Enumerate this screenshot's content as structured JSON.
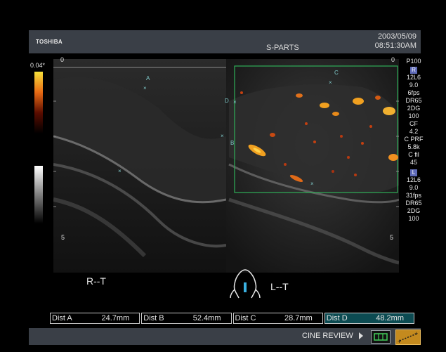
{
  "header": {
    "brand": "TOSHIBA",
    "preset": "S-PARTS",
    "date": "2003/05/09",
    "time": "08:51:30AM"
  },
  "image": {
    "depth_top": "0",
    "depth_mid": "5",
    "color_scale_top": "0.04*",
    "labels": {
      "left": "R--T",
      "right": "L--T"
    },
    "markers": [
      "A",
      "B",
      "C",
      "D"
    ]
  },
  "params_upper": {
    "power": "P100",
    "r_badge": "R",
    "probe": "12L6",
    "freq": "9.0",
    "fps": "6fps",
    "dr": "DR65",
    "mode": "2DG",
    "gain": "100",
    "cf_label": "CF",
    "cf": "4.2",
    "cprf_label": "C PRF",
    "cprf": "5.8k",
    "cfil_label": "C fil",
    "cfil": "45"
  },
  "params_lower": {
    "l_badge": "L",
    "probe": "12L6",
    "freq": "9.0",
    "fps": "31fps",
    "dr": "DR65",
    "mode": "2DG",
    "gain": "100"
  },
  "measurements": [
    {
      "key": "Dist A",
      "value": "24.7mm"
    },
    {
      "key": "Dist B",
      "value": "52.4mm"
    },
    {
      "key": "Dist C",
      "value": "28.7mm"
    },
    {
      "key": "Dist D",
      "value": "48.2mm"
    }
  ],
  "footer": {
    "cine": "CINE REVIEW"
  },
  "colors": {
    "panel": "#3a3f47",
    "roi": "#2fae58",
    "accent": "#0c4b52"
  }
}
